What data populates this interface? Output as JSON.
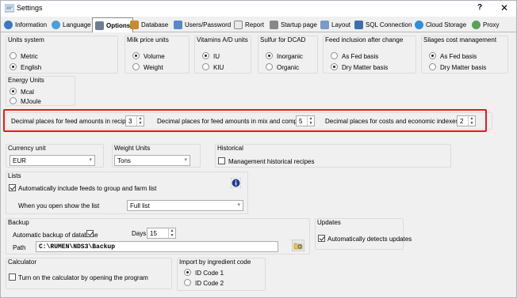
{
  "window": {
    "title": "Settings",
    "help": "?",
    "close": "✕"
  },
  "tabs": [
    {
      "label": "Information",
      "icon": "info-icon",
      "active": false
    },
    {
      "label": "Language",
      "icon": "globe-icon",
      "active": false
    },
    {
      "label": "Options",
      "icon": "options-icon",
      "active": true
    },
    {
      "label": "Database",
      "icon": "database-icon",
      "active": false
    },
    {
      "label": "Users/Password",
      "icon": "users-icon",
      "active": false
    },
    {
      "label": "Report",
      "icon": "report-icon",
      "active": false
    },
    {
      "label": "Startup page",
      "icon": "startup-icon",
      "active": false
    },
    {
      "label": "Layout",
      "icon": "layout-icon",
      "active": false
    },
    {
      "label": "SQL Connection",
      "icon": "sql-icon",
      "active": false
    },
    {
      "label": "Cloud Storage",
      "icon": "cloud-icon",
      "active": false
    },
    {
      "label": "Proxy",
      "icon": "proxy-icon",
      "active": false
    }
  ],
  "units_system": {
    "title": "Units system",
    "options": [
      "Metric",
      "English"
    ],
    "selected": "English"
  },
  "milk_price": {
    "title": "Milk price units",
    "options": [
      "Volume",
      "Weight"
    ],
    "selected": "Volume"
  },
  "vitamins": {
    "title": "Vitamins A/D units",
    "options": [
      "IU",
      "KIU"
    ],
    "selected": "IU"
  },
  "sulfur": {
    "title": "Sulfur for DCAD",
    "options": [
      "Inorganic",
      "Organic"
    ],
    "selected": "Inorganic"
  },
  "feed_inclusion": {
    "title": "Feed inclusion after change",
    "options": [
      "As Fed basis",
      "Dry Matter basis"
    ],
    "selected": "Dry Matter basis"
  },
  "silages": {
    "title": "Silages cost management",
    "options": [
      "As Fed basis",
      "Dry Matter basis"
    ],
    "selected": "As Fed basis"
  },
  "energy_units": {
    "title": "Energy Units",
    "options": [
      "Mcal",
      "MJoule"
    ],
    "selected": "Mcal"
  },
  "decimals": {
    "recipes_label": "Decimal places for feed amounts in recipes",
    "recipes_value": "3",
    "mix_label": "Decimal places for feed amounts in mix and composites",
    "mix_value": "5",
    "costs_label": "Decimal places for costs and economic indexes",
    "costs_value": "2"
  },
  "currency": {
    "title": "Currency unit",
    "value": "EUR"
  },
  "weight_units": {
    "title": "Weight Units",
    "value": "Tons"
  },
  "historical": {
    "title": "Historical",
    "check_label": "Management historical recipes",
    "checked": false
  },
  "lists": {
    "title": "Lists",
    "auto_include_label": "Automatically include feeds to group and farm list",
    "auto_include_checked": true,
    "open_label": "When you open show the list",
    "open_value": "Full list"
  },
  "backup": {
    "title": "Backup",
    "auto_label": "Automatic backup of database",
    "auto_checked": true,
    "days_label": "Days",
    "days_value": "15",
    "path_label": "Path",
    "path_value": "C:\\RUMEN\\NDS3\\Backup"
  },
  "updates": {
    "title": "Updates",
    "check_label": "Automatically detects updates",
    "checked": true
  },
  "calculator": {
    "title": "Calculator",
    "check_label": "Turn on the calculator by opening the program",
    "checked": false
  },
  "import_code": {
    "title": "Import by ingredient code",
    "options": [
      "ID Code 1",
      "ID Code 2"
    ],
    "selected": "ID Code 1"
  },
  "colors": {
    "highlight": "#e01b1b",
    "info_button": "#1f3f8f"
  }
}
